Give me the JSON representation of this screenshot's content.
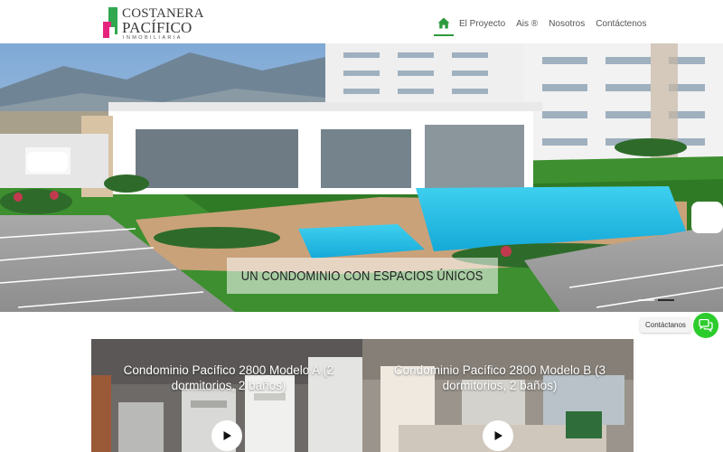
{
  "brand": {
    "line1": "COSTANERA",
    "line2": "PACÍFICO",
    "line3": "INMOBILIARIA",
    "colors": {
      "green": "#2fa84f",
      "pink": "#e6237e"
    }
  },
  "nav": {
    "home_icon": "home-icon",
    "items": [
      {
        "label": "El Proyecto"
      },
      {
        "label": "Ais ®"
      },
      {
        "label": "Nosotros"
      },
      {
        "label": "Contáctenos"
      }
    ],
    "active_color": "#2e9a3e"
  },
  "hero": {
    "caption": "UN CONDOMINIO CON ESPACIOS ÚNICOS",
    "slides": 2,
    "active_slide": 2
  },
  "chat": {
    "label": "Contáctanos",
    "icon": "chat-bubbles-icon",
    "color": "#2dcc2d"
  },
  "videos": [
    {
      "title": "Condominio Pacífico 2800 Modelo A (2 dormitorios, 2 baños)",
      "icon": "play-icon"
    },
    {
      "title": "Condominio Pacífico 2800 Modelo B (3 dormitorios, 2 baños)",
      "icon": "play-icon"
    }
  ]
}
